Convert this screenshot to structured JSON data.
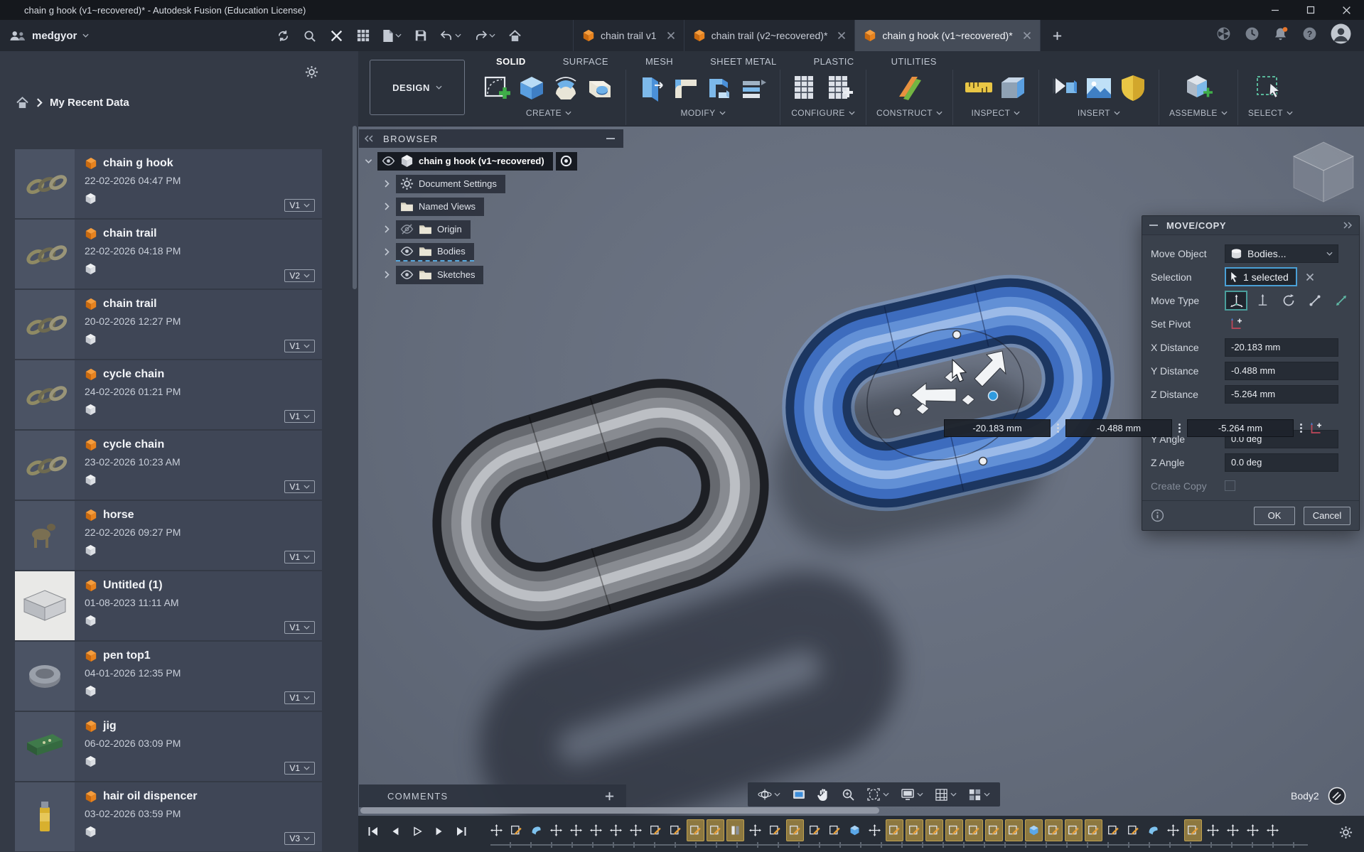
{
  "title_bar": {
    "title": "chain g hook (v1~recovered)* - Autodesk Fusion (Education License)",
    "window_controls": [
      "minimize",
      "maximize",
      "close"
    ]
  },
  "app_bar": {
    "user": "medgyor",
    "tool_icons": [
      {
        "icon": "sync",
        "caret": false
      },
      {
        "icon": "search",
        "caret": false
      },
      {
        "icon": "close-panel",
        "caret": false
      },
      {
        "icon": "apps-grid",
        "caret": false
      },
      {
        "icon": "file-new",
        "caret": true
      },
      {
        "icon": "save",
        "caret": false
      },
      {
        "icon": "undo",
        "caret": true
      },
      {
        "icon": "redo",
        "caret": true
      },
      {
        "icon": "home",
        "caret": false
      }
    ],
    "tabs": [
      {
        "label": "chain trail v1",
        "active": false
      },
      {
        "label": "chain trail (v2~recovered)*",
        "active": false
      },
      {
        "label": "chain g hook (v1~recovered)*",
        "active": true
      }
    ],
    "right_icons": [
      "extensions",
      "job-status",
      "notifications",
      "help",
      "avatar"
    ],
    "notification_color": "#e8762c"
  },
  "data_panel": {
    "breadcrumb": "My Recent Data",
    "items": [
      {
        "name": "chain g hook",
        "date": "22-02-2026 04:47 PM",
        "version": "V1",
        "thumb": "chain"
      },
      {
        "name": "chain trail",
        "date": "22-02-2026 04:18 PM",
        "version": "V2",
        "thumb": "chain"
      },
      {
        "name": "chain trail",
        "date": "20-02-2026 12:27 PM",
        "version": "V1",
        "thumb": "chain"
      },
      {
        "name": "cycle chain",
        "date": "24-02-2026 01:21 PM",
        "version": "V1",
        "thumb": "chain"
      },
      {
        "name": "cycle chain",
        "date": "23-02-2026 10:23 AM",
        "version": "V1",
        "thumb": "chain"
      },
      {
        "name": "horse",
        "date": "22-02-2026 09:27 PM",
        "version": "V1",
        "thumb": "horse"
      },
      {
        "name": "Untitled (1)",
        "date": "01-08-2023 11:11 AM",
        "version": "V1",
        "thumb": "light-box"
      },
      {
        "name": "pen top1",
        "date": "04-01-2026 12:35 PM",
        "version": "V1",
        "thumb": "pen"
      },
      {
        "name": "jig",
        "date": "06-02-2026 03:09 PM",
        "version": "V1",
        "thumb": "jig"
      },
      {
        "name": "hair oil dispencer",
        "date": "03-02-2026 03:59 PM",
        "version": "V3",
        "thumb": "bottle"
      }
    ]
  },
  "ribbon": {
    "design_label": "DESIGN",
    "tabs": [
      "SOLID",
      "SURFACE",
      "MESH",
      "SHEET METAL",
      "PLASTIC",
      "UTILITIES"
    ],
    "active_tab": "SOLID",
    "groups": [
      {
        "label": "CREATE",
        "icons": [
          "create-sketch",
          "extrude",
          "revolve",
          "hole"
        ]
      },
      {
        "label": "MODIFY",
        "icons": [
          "press-pull",
          "fillet",
          "shell",
          "pattern"
        ]
      },
      {
        "label": "CONFIGURE",
        "icons": [
          "configure-table",
          "configure-insert"
        ]
      },
      {
        "label": "CONSTRUCT",
        "icons": [
          "construction-plane"
        ]
      },
      {
        "label": "INSPECT",
        "icons": [
          "measure",
          "section-analysis"
        ]
      },
      {
        "label": "INSERT",
        "icons": [
          "insert-derive",
          "insert-canvas",
          "insert-decal"
        ]
      },
      {
        "label": "ASSEMBLE",
        "icons": [
          "new-component"
        ]
      },
      {
        "label": "SELECT",
        "icons": [
          "select-tool"
        ]
      }
    ]
  },
  "browser": {
    "title": "BROWSER",
    "root_label": "chain g hook (v1~recovered)",
    "items": [
      {
        "label": "Document Settings",
        "icon": "gear",
        "eye": "none",
        "selected": false
      },
      {
        "label": "Named Views",
        "icon": "folder",
        "eye": "none",
        "selected": false
      },
      {
        "label": "Origin",
        "icon": "folder",
        "eye": "off",
        "selected": false
      },
      {
        "label": "Bodies",
        "icon": "folder",
        "eye": "on",
        "selected": true
      },
      {
        "label": "Sketches",
        "icon": "folder",
        "eye": "on",
        "selected": false
      }
    ]
  },
  "move_dialog": {
    "title": "MOVE/COPY",
    "move_object_label": "Move Object",
    "move_object_value": "Bodies...",
    "selection_label": "Selection",
    "selection_value": "1 selected",
    "move_type_label": "Move Type",
    "move_types": [
      "free-move",
      "translate",
      "rotate",
      "point-to-point",
      "point-to-position"
    ],
    "move_type_selected": 0,
    "set_pivot_label": "Set Pivot",
    "x_distance_label": "X Distance",
    "x_distance_value": "-20.183 mm",
    "y_distance_label": "Y Distance",
    "y_distance_value": "-0.488 mm",
    "z_distance_label": "Z Distance",
    "z_distance_value": "-5.264 mm",
    "y_angle_label": "Y Angle",
    "y_angle_value": "0.0 deg",
    "z_angle_label": "Z Angle",
    "z_angle_value": "0.0 deg",
    "create_copy_label": "Create Copy",
    "ok_label": "OK",
    "cancel_label": "Cancel"
  },
  "viewport": {
    "floating_values": [
      "-20.183 mm",
      "-0.488 mm",
      "-5.264 mm"
    ],
    "comments_label": "COMMENTS",
    "body_label": "Body2",
    "nav_icons": [
      {
        "icon": "orbit",
        "caret": true
      },
      {
        "icon": "look-at",
        "caret": false
      },
      {
        "icon": "pan",
        "caret": false
      },
      {
        "icon": "zoom",
        "caret": false
      },
      {
        "icon": "fit",
        "caret": true
      },
      {
        "icon": "display-settings",
        "caret": true
      },
      {
        "icon": "grid-display",
        "caret": true
      },
      {
        "icon": "viewports",
        "caret": true
      }
    ],
    "selection_color": "#3d6cbe"
  },
  "timeline": {
    "playback": [
      "skip-start",
      "step-back",
      "play",
      "step-forward",
      "skip-end"
    ],
    "features": [
      "m",
      "s",
      "b",
      "m",
      "m",
      "m",
      "m",
      "m",
      "s",
      "s",
      "s!",
      "s!",
      "p!",
      "m",
      "s",
      "s!",
      "s",
      "s",
      "e",
      "m",
      "s!",
      "s!",
      "s!",
      "s!",
      "s!",
      "s!",
      "s!",
      "e!",
      "s!",
      "s!",
      "s!",
      "s",
      "s",
      "b",
      "m",
      "s!",
      "m",
      "m",
      "m",
      "m"
    ],
    "highlight_color": "#8d7840"
  }
}
